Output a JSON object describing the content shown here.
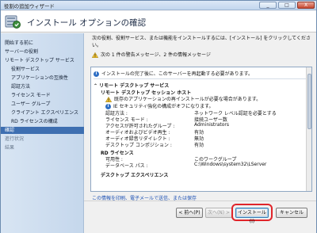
{
  "window": {
    "title": "役割の追加ウィザード",
    "controls": [
      "_",
      "□",
      "X"
    ]
  },
  "header": {
    "title": "インストール オプションの確認"
  },
  "nav": {
    "items": [
      {
        "label": "開始する前に",
        "state": "normal"
      },
      {
        "label": "サーバーの役割",
        "state": "normal"
      },
      {
        "label": "リモート デスクトップ サービス",
        "state": "normal"
      },
      {
        "label": "役割サービス",
        "state": "normal",
        "indent": true
      },
      {
        "label": "アプリケーションの互換性",
        "state": "normal",
        "indent": true
      },
      {
        "label": "認証方法",
        "state": "normal",
        "indent": true
      },
      {
        "label": "ライセンス モード",
        "state": "normal",
        "indent": true
      },
      {
        "label": "ユーザー グループ",
        "state": "normal",
        "indent": true
      },
      {
        "label": "クライアント エクスペリエンス",
        "state": "normal",
        "indent": true
      },
      {
        "label": "RD ライセンスの構成",
        "state": "normal",
        "indent": true
      },
      {
        "label": "確認",
        "state": "selected"
      },
      {
        "label": "進行状況",
        "state": "disabled"
      },
      {
        "label": "結果",
        "state": "disabled"
      }
    ]
  },
  "content": {
    "description": "次の役割、役割サービス、または機能をインストールするには、[インストール] をクリックしてください。",
    "summary": "次の 1 件の警告メッセージ、2 件の情報メッセージ",
    "panel": {
      "info_line": "インストールの完了後に、このサーバーを再起動する必要があります。",
      "section_title": "リモート デスクトップ サービス",
      "subsection_host": "リモート デスクトップ セッション ホスト",
      "warning_note": "既存のアプリケーションの再インストールが必要な場合があります。",
      "ie_note": "IE セキュリティ強化の構成がオフになります。",
      "rows": [
        {
          "label": "認証方法 :",
          "value": "ネットワーク レベル認証を必要とする"
        },
        {
          "label": "ライセンス モード :",
          "value": "接続ユーザー数"
        },
        {
          "label": "アクセスが許可されたグループ :",
          "value": "Administrators"
        },
        {
          "label": "オーディオおよびビデオ再生 :",
          "value": "有効"
        },
        {
          "label": "オーディオ録音リダイレクト :",
          "value": "無効"
        },
        {
          "label": "デスクトップ コンポジション :",
          "value": "有効"
        }
      ],
      "subsection_rd": "RD ライセンス",
      "rd_rows": [
        {
          "label": "可用性 :",
          "value": "このワークグループ"
        },
        {
          "label": "データベース パス :",
          "value": "C:\\Windows\\system32\\LServer"
        }
      ],
      "subsection_desktop": "デスクトップ エクスペリエンス"
    },
    "link": "この情報を印刷、電子メールで送信、または保存"
  },
  "footer": {
    "back": "< 前へ(P)",
    "next": "次へ(N) >",
    "install": "インストール(I)",
    "cancel": "キャンセル"
  },
  "colors": {
    "accent": "#3e6fb1",
    "highlight": "#e0242a"
  }
}
